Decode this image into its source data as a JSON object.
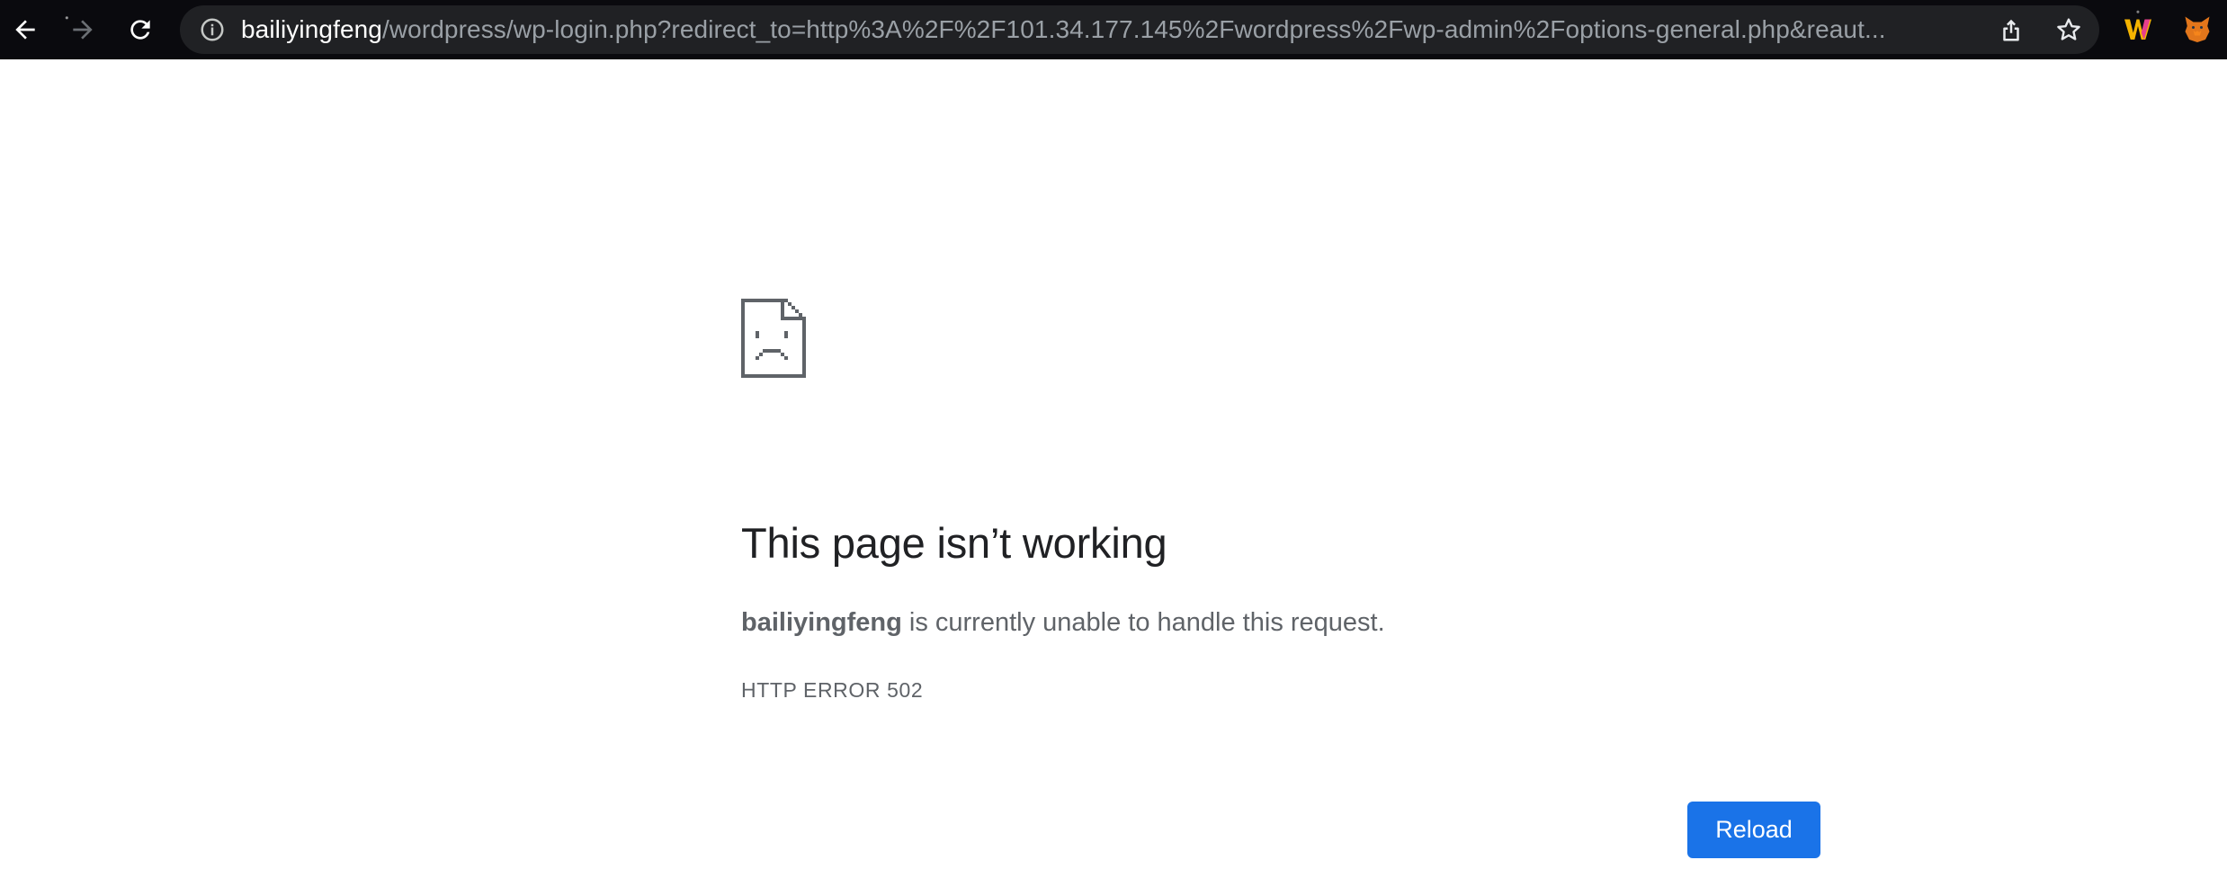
{
  "browser": {
    "url_host": "bailiyingfeng",
    "url_path": "/wordpress/wp-login.php?redirect_to=http%3A%2F%2F101.34.177.145%2Fwordpress%2Fwp-admin%2Foptions-general.php&reaut...",
    "icons": {
      "back": "back-arrow-icon",
      "forward": "forward-arrow-icon",
      "reload": "reload-icon",
      "site_info": "info-icon",
      "share": "share-icon",
      "bookmark": "star-icon",
      "extension_1": "w-extension-icon",
      "extension_2": "fox-extension-icon"
    }
  },
  "error_page": {
    "title": "This page isn’t working",
    "host": "bailiyingfeng",
    "message": " is currently unable to handle this request.",
    "error_code": "HTTP ERROR 502",
    "reload_label": "Reload",
    "icon": "sad-page-icon"
  },
  "colors": {
    "toolbar_bg": "#0a0a0e",
    "omnibox_bg": "#202124",
    "title_text": "#202124",
    "body_text": "#5f6368",
    "accent_button": "#1a73e8"
  }
}
